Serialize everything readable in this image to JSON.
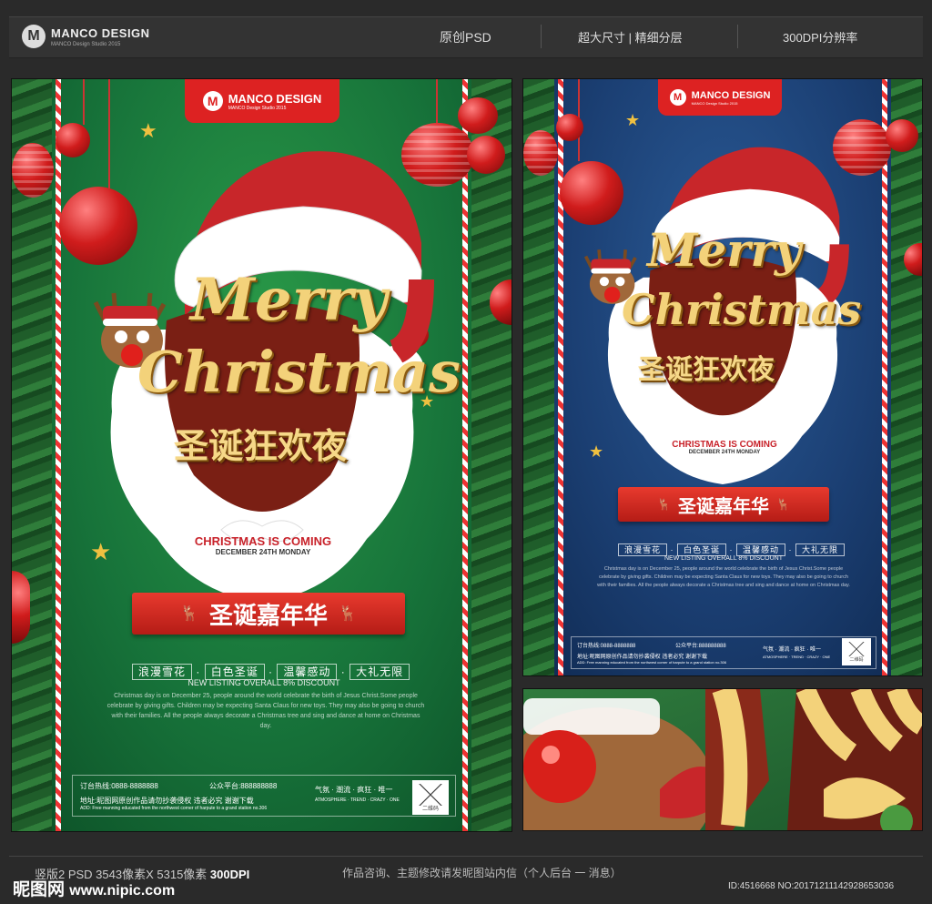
{
  "header": {
    "brand": "MANCO DESIGN",
    "brand_sub": "MANCO Design Studio 2015",
    "items": [
      "原创PSD",
      "超大尺寸 | 精细分层",
      "300DPI分辨率"
    ]
  },
  "poster": {
    "logo": "MANCO DESIGN",
    "logo_sub": "MANCO Design Studio 2015",
    "merry": "Merry",
    "christmas": "Christmas",
    "cn_title": "圣诞狂欢夜",
    "coming": "CHRISTMAS IS COMING",
    "date": "DECEMBER 24TH MONDAY",
    "ribbon": "圣诞嘉年华",
    "slogans": [
      "浪漫雪花",
      "白色圣诞",
      "温馨感动",
      "大礼无限"
    ],
    "listing": "NEW LISTING OVERALL 8% DISCOUNT",
    "body": "Christmas day is on December 25, people around the world celebrate the birth of Jesus Christ.Some people celebrate by giving gifts. Children may be expecting Santa Claus for new toys. They may also be going to church with their families. All the people always decorate a Christmas tree and sing and dance at home on Christmas day.",
    "hotline": "订台热线:0888-8888888",
    "platform": "公众平台:888888888",
    "address": "地址:昵图网原创作品请勿抄袭侵权 违者必究 谢谢下载",
    "address_en": "ADD: Free manning educated from the northwest corner of harpute to a grand station no.306",
    "atmosphere": "气氛 · 潮流 · 疯狂 · 唯一",
    "atmosphere_en": "ATMOSPHERE · TREND · CRAZY · ONE",
    "qr": "二维码"
  },
  "bottom": {
    "spec_prefix": "竖版2 PSD  3543像素X 5315像素 ",
    "spec_dpi": "300DPI",
    "consult": "作品咨询、主题修改请发昵图站内信（个人后台 一 消息）",
    "watermark": "昵图网",
    "watermark_url": "www.nipic.com",
    "id": "ID:4516668 NO:20171211142928653036"
  },
  "colors": {
    "green_bg": "#17733a",
    "blue_bg": "#1b3f73",
    "red": "#d22222",
    "gold": "#f3d27a"
  }
}
